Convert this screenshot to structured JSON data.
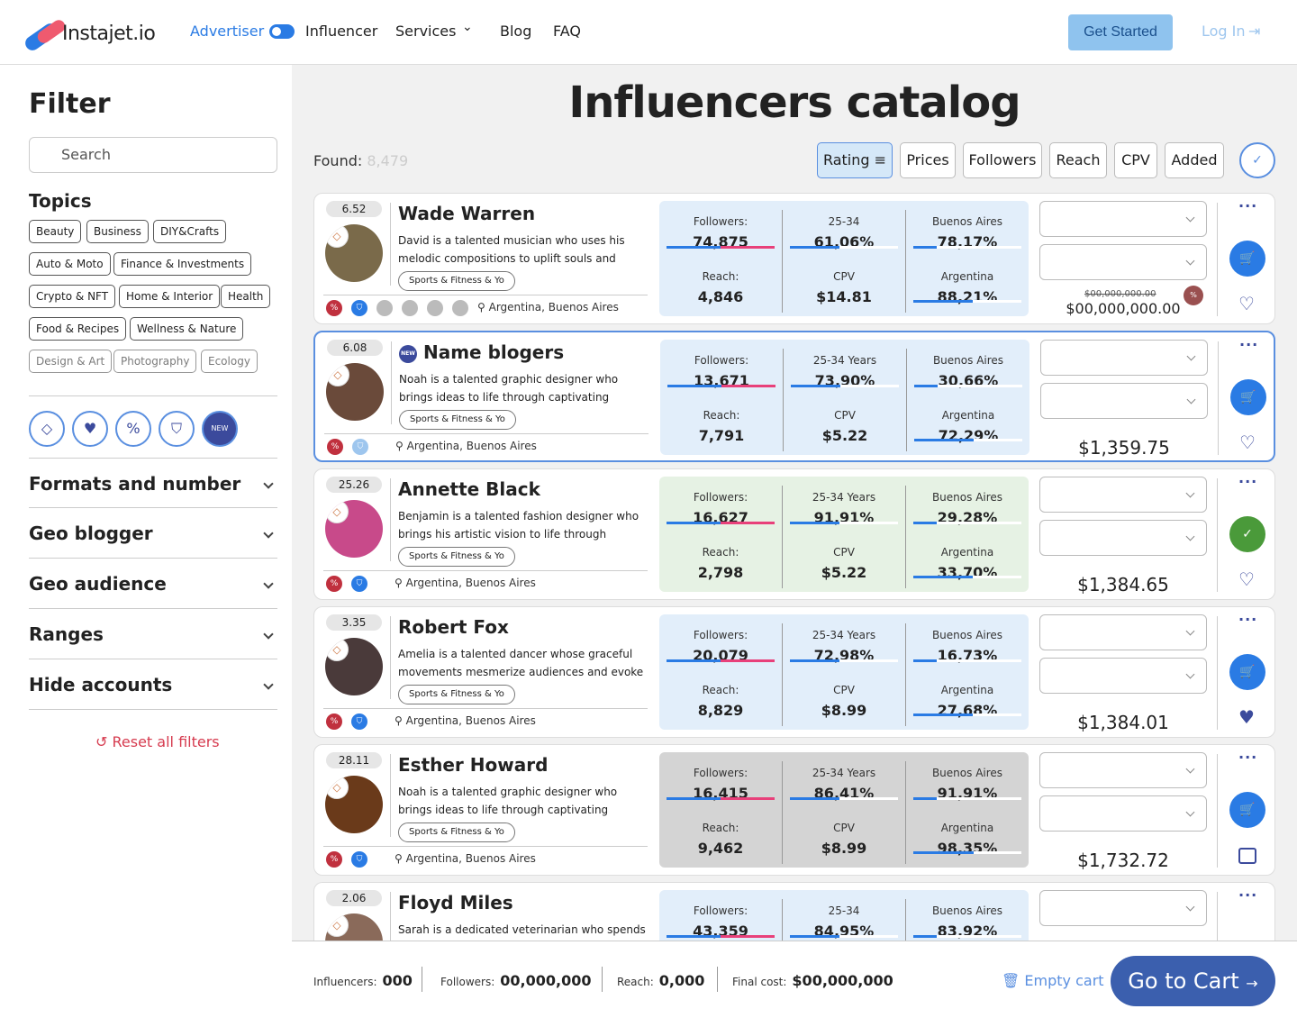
{
  "header": {
    "logo": "Instajet.io",
    "advertiser": "Advertiser",
    "influencer": "Influencer",
    "services": "Services",
    "blog": "Blog",
    "faq": "FAQ",
    "get_started": "Get Started",
    "login": "Log In"
  },
  "filter": {
    "title": "Filter",
    "search_placeholder": "Search",
    "topics_title": "Topics",
    "topics": [
      "Beauty",
      "Business",
      "DIY&Crafts",
      "Auto & Moto",
      "Finance & Investments",
      "Crypto & NFT",
      "Home & Interior",
      "Health",
      "Food & Recipes",
      "Wellness & Nature",
      "Design & Art",
      "Photography",
      "Ecology"
    ],
    "sections": [
      "Formats and number",
      "Geo blogger",
      "Geo audience",
      "Ranges",
      "Hide accounts"
    ],
    "reset": "Reset all filters"
  },
  "main": {
    "title": "Influencers catalog",
    "found_label": "Found:",
    "found_value": "8,479",
    "sort": [
      "Rating",
      "Prices",
      "Followers",
      "Reach",
      "CPV",
      "Added"
    ]
  },
  "cards": [
    {
      "rating": "6.52",
      "name": "Wade Warren",
      "desc": "David is a talented musician who uses his melodic compositions to uplift souls and create...",
      "tag": "Sports & Fitness & Yo",
      "geo": "Argentina, Buenos Aires",
      "followers_label": "Followers:",
      "followers": "74,875",
      "age_label": "25-34",
      "age": "61,06%",
      "city_label": "Buenos Aires",
      "city": "78,17%",
      "reach_label": "Reach:",
      "reach": "4,846",
      "cpv_label": "CPV",
      "cpv": "$14.81",
      "country_label": "Argentina",
      "country": "88,21%",
      "old_price": "$00,000,000.00",
      "price": "$00,000,000.00"
    },
    {
      "rating": "6.08",
      "name": "Name blogers",
      "desc": "Noah is a talented graphic designer who brings ideas to life through captivating visuals. His crea...",
      "tag": "Sports & Fitness & Yo",
      "geo": "Argentina, Buenos Aires",
      "followers_label": "Followers:",
      "followers": "13,671",
      "age_label": "25-34 Years",
      "age": "73,90%",
      "city_label": "Buenos Aires",
      "city": "30,66%",
      "reach_label": "Reach:",
      "reach": "7,791",
      "cpv_label": "CPV",
      "cpv": "$5.22",
      "country_label": "Argentina",
      "country": "72,29%",
      "price": "$1,359.75"
    },
    {
      "rating": "25.26",
      "name": "Annette Black",
      "desc": "Benjamin is a talented fashion designer who brings his artistic vision to life through elegant a...",
      "tag": "Sports & Fitness & Yo",
      "geo": "Argentina, Buenos Aires",
      "followers_label": "Followers:",
      "followers": "16,627",
      "age_label": "25-34 Years",
      "age": "91,91%",
      "city_label": "Buenos Aires",
      "city": "29,28%",
      "reach_label": "Reach:",
      "reach": "2,798",
      "cpv_label": "CPV",
      "cpv": "$5.22",
      "country_label": "Argentina",
      "country": "33,70%",
      "price": "$1,384.65"
    },
    {
      "rating": "3.35",
      "name": "Robert Fox",
      "desc": "Amelia is a talented dancer whose graceful movements mesmerize audiences and evoke a r...",
      "tag": "Sports & Fitness & Yo",
      "geo": "Argentina, Buenos Aires",
      "followers_label": "Followers:",
      "followers": "20,079",
      "age_label": "25-34 Years",
      "age": "72,98%",
      "city_label": "Buenos Aires",
      "city": "16,73%",
      "reach_label": "Reach:",
      "reach": "8,829",
      "cpv_label": "CPV",
      "cpv": "$8.99",
      "country_label": "Argentina",
      "country": "27,68%",
      "price": "$1,384.01"
    },
    {
      "rating": "28.11",
      "name": "Esther Howard",
      "desc": "Noah is a talented graphic designer who brings ideas to life through captivating visuals. His crea...",
      "tag": "Sports & Fitness & Yo",
      "geo": "Argentina, Buenos Aires",
      "followers_label": "Followers:",
      "followers": "16,415",
      "age_label": "25-34 Years",
      "age": "86,41%",
      "city_label": "Buenos Aires",
      "city": "91,91%",
      "reach_label": "Reach:",
      "reach": "9,462",
      "cpv_label": "CPV",
      "cpv": "$8.99",
      "country_label": "Argentina",
      "country": "98,35%",
      "price": "$1,732.72"
    },
    {
      "rating": "2.06",
      "name": "Floyd Miles",
      "desc": "Sarah is a dedicated veterinarian who spends her",
      "followers_label": "Followers:",
      "followers": "43,359",
      "age_label": "25-34",
      "age": "84,95%",
      "city_label": "Buenos Aires",
      "city": "83,92%"
    }
  ],
  "footer": {
    "influencers_label": "Influencers:",
    "influencers": "000",
    "followers_label": "Followers:",
    "followers": "00,000,000",
    "reach_label": "Reach:",
    "reach": "0,000",
    "cost_label": "Final cost:",
    "cost": "$00,000,000",
    "empty": "Empty cart",
    "go": "Go to Cart"
  },
  "colors": {
    "accent": "#2a7be4",
    "brand_red": "#ef5a6f",
    "button_dark": "#3b5fae"
  }
}
